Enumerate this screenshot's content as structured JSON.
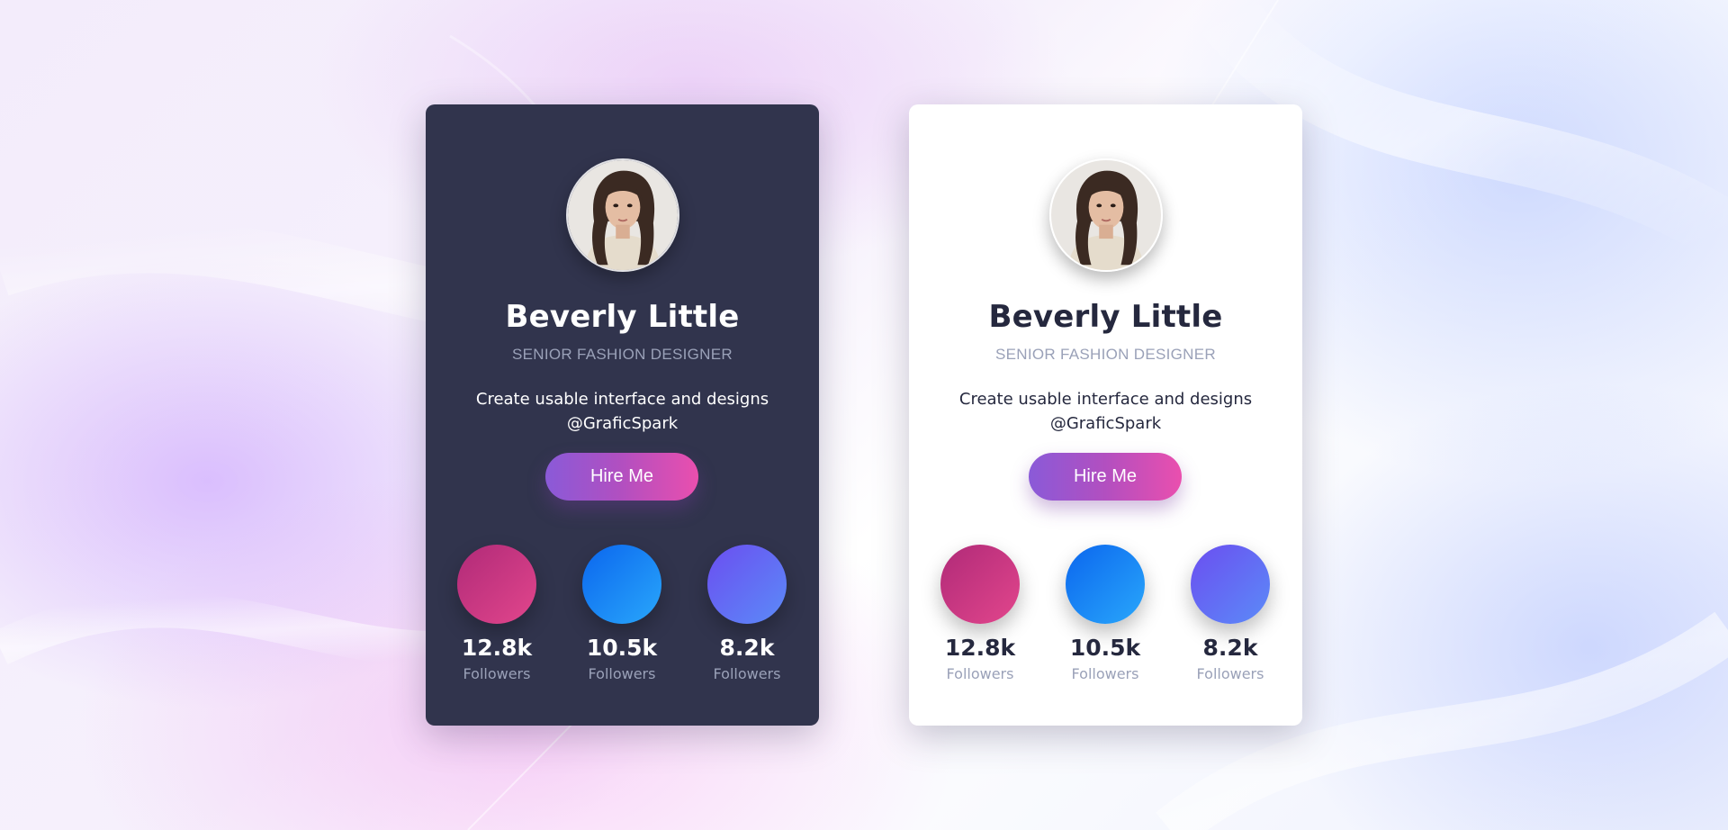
{
  "colors": {
    "dark_card_bg": "#31344d",
    "light_card_bg": "#ffffff",
    "muted_text": "#9aa1b8",
    "button_gradient": [
      "#8a5ad8",
      "#ea4fae"
    ],
    "social_pink": [
      "#b02a78",
      "#e2468c"
    ],
    "social_blue": [
      "#0b66ee",
      "#29a7fb"
    ],
    "social_purple": [
      "#6b4ef0",
      "#5b8bf8"
    ]
  },
  "cards": [
    {
      "theme": "dark",
      "name": "Beverly Little",
      "role": "SENIOR FASHION DESIGNER",
      "bio": "Create usable interface and designs @GraficSpark",
      "button_label": "Hire Me",
      "stats": [
        {
          "count": "12.8k",
          "label": "Followers",
          "icon": "pink-circle-icon"
        },
        {
          "count": "10.5k",
          "label": "Followers",
          "icon": "blue-circle-icon"
        },
        {
          "count": "8.2k",
          "label": "Followers",
          "icon": "purple-circle-icon"
        }
      ]
    },
    {
      "theme": "light",
      "name": "Beverly Little",
      "role": "SENIOR FASHION DESIGNER",
      "bio": "Create usable interface and designs @GraficSpark",
      "button_label": "Hire Me",
      "stats": [
        {
          "count": "12.8k",
          "label": "Followers",
          "icon": "pink-circle-icon"
        },
        {
          "count": "10.5k",
          "label": "Followers",
          "icon": "blue-circle-icon"
        },
        {
          "count": "8.2k",
          "label": "Followers",
          "icon": "purple-circle-icon"
        }
      ]
    }
  ]
}
